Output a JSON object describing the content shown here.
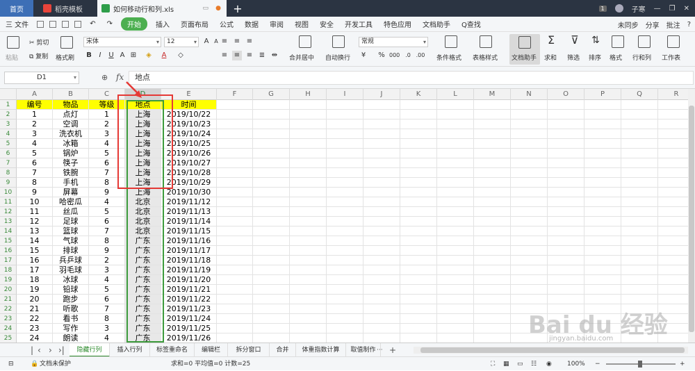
{
  "titlebar": {
    "tabs": [
      "首页",
      "稻壳模板",
      "如何移动行和列.xls"
    ],
    "page_count": "1",
    "user": "子寒",
    "add": "+"
  },
  "menubar": {
    "file": "三 文件",
    "items": [
      "开始",
      "插入",
      "页面布局",
      "公式",
      "数据",
      "审阅",
      "视图",
      "安全",
      "开发工具",
      "特色应用",
      "文档助手",
      "Q查找"
    ],
    "right": [
      "未同步",
      "分享",
      "批注",
      "?"
    ]
  },
  "ribbon": {
    "paste": "粘贴",
    "cut": "剪切",
    "copy": "复制",
    "format_painter": "格式刷",
    "font": "宋体",
    "size": "12",
    "merge": "合并居中",
    "wrap": "自动换行",
    "numfmt": "常规",
    "cond_format": "条件格式",
    "table_style": "表格样式",
    "doc_assist": "文档助手",
    "sum": "求和",
    "filter": "筛选",
    "sort": "排序",
    "format": "格式",
    "row_col": "行和列",
    "worksheet": "工作表",
    "percent": "%",
    "currency": "¥"
  },
  "formula": {
    "cell_ref": "D1",
    "fx": "fx",
    "value": "地点"
  },
  "columns": [
    "A",
    "B",
    "C",
    "D",
    "E",
    "F",
    "G",
    "H",
    "I",
    "J",
    "K",
    "L",
    "M",
    "N",
    "O",
    "P",
    "Q",
    "R"
  ],
  "header_row": [
    "编号",
    "物品",
    "等级",
    "地点",
    "时间"
  ],
  "rows": [
    [
      "1",
      "点灯",
      "1",
      "上海",
      "2019/10/22"
    ],
    [
      "2",
      "空调",
      "2",
      "上海",
      "2019/10/23"
    ],
    [
      "3",
      "洗衣机",
      "3",
      "上海",
      "2019/10/24"
    ],
    [
      "4",
      "冰箱",
      "4",
      "上海",
      "2019/10/25"
    ],
    [
      "5",
      "锅炉",
      "5",
      "上海",
      "2019/10/26"
    ],
    [
      "6",
      "筷子",
      "6",
      "上海",
      "2019/10/27"
    ],
    [
      "7",
      "铁腕",
      "7",
      "上海",
      "2019/10/28"
    ],
    [
      "8",
      "手机",
      "8",
      "上海",
      "2019/10/29"
    ],
    [
      "9",
      "屏幕",
      "9",
      "上海",
      "2019/10/30"
    ],
    [
      "10",
      "哈密瓜",
      "4",
      "北京",
      "2019/11/12"
    ],
    [
      "11",
      "丝瓜",
      "5",
      "北京",
      "2019/11/13"
    ],
    [
      "12",
      "足球",
      "6",
      "北京",
      "2019/11/14"
    ],
    [
      "13",
      "篮球",
      "7",
      "北京",
      "2019/11/15"
    ],
    [
      "14",
      "气球",
      "8",
      "广东",
      "2019/11/16"
    ],
    [
      "15",
      "排球",
      "9",
      "广东",
      "2019/11/17"
    ],
    [
      "16",
      "兵乒球",
      "2",
      "广东",
      "2019/11/18"
    ],
    [
      "17",
      "羽毛球",
      "3",
      "广东",
      "2019/11/19"
    ],
    [
      "18",
      "冰球",
      "4",
      "广东",
      "2019/11/20"
    ],
    [
      "19",
      "铅球",
      "5",
      "广东",
      "2019/11/21"
    ],
    [
      "20",
      "跑步",
      "6",
      "广东",
      "2019/11/22"
    ],
    [
      "21",
      "听歌",
      "7",
      "广东",
      "2019/11/23"
    ],
    [
      "22",
      "看书",
      "8",
      "广东",
      "2019/11/24"
    ],
    [
      "23",
      "写作",
      "3",
      "广东",
      "2019/11/25"
    ],
    [
      "24",
      "朗读",
      "4",
      "广东",
      "2019/11/26"
    ]
  ],
  "sheets": [
    "隐藏行列",
    "插入行列",
    "标签重命名",
    "编辑栏",
    "拆分窗口",
    "合并",
    "体重指数计算",
    "取值制作"
  ],
  "sheet_more": "···",
  "status": {
    "protect": "文档未保护",
    "stats": "求和=0  平均值=0  计数=25",
    "zoom": "100%"
  },
  "watermark": "Bai du 经验",
  "watermark_url": "jingyan.baidu.com",
  "colors": {
    "accent": "#4caf50",
    "header_fill": "#ffff00",
    "selection": "#3d9b3d",
    "highlight": "#e53935"
  }
}
